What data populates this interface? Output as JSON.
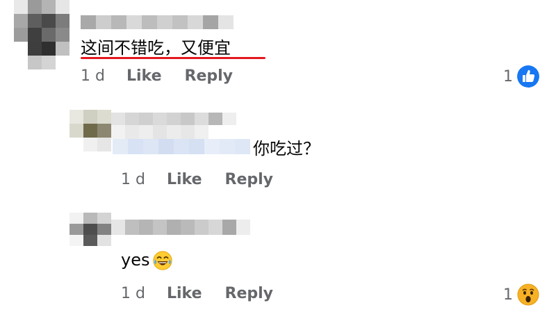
{
  "comments": [
    {
      "text": "这间不错吃，又便宜",
      "time": "1 d",
      "like_label": "Like",
      "reply_label": "Reply",
      "reaction_count": "1",
      "reaction_icon": "like-thumb-icon"
    },
    {
      "text": "你吃过？",
      "time": "1 d",
      "like_label": "Like",
      "reply_label": "Reply"
    },
    {
      "text": "yes",
      "emoji_icon": "laughing-tears-emoji-icon",
      "time": "1 d",
      "like_label": "Like",
      "reply_label": "Reply",
      "reaction_count": "1",
      "reaction_icon": "wow-face-icon"
    }
  ],
  "colors": {
    "underline": "#e4171e",
    "meta_text": "#65676b",
    "like_blue": "#1877f2",
    "wow_yellow": "#f7b125"
  }
}
